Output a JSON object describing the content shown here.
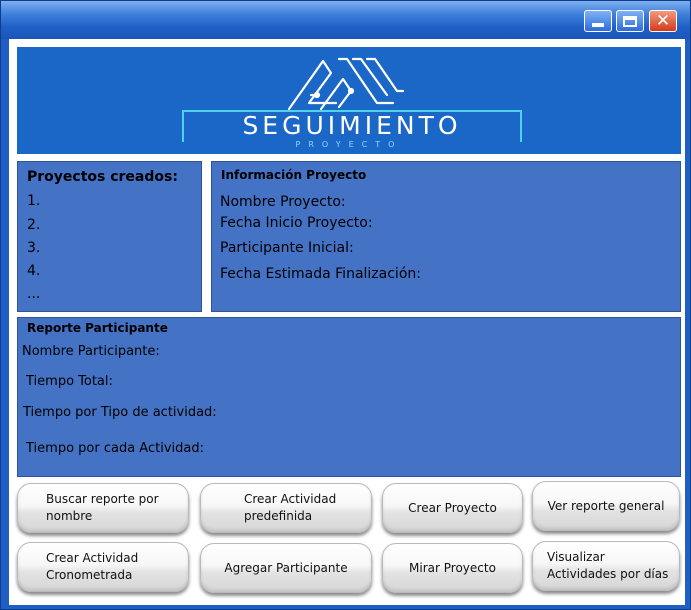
{
  "logo": {
    "title": "SEGUIMIENTO",
    "subtitle": "PROYECTO"
  },
  "projects_panel": {
    "title": "Proyectos creados:",
    "items": [
      "1.",
      "2.",
      "3.",
      "4.",
      "..."
    ]
  },
  "info_panel": {
    "title": "Información Proyecto",
    "fields": [
      "Nombre Proyecto:",
      "Fecha Inicio Proyecto:",
      "Participante Inicial:",
      "Fecha Estimada Finalización:"
    ]
  },
  "report_panel": {
    "title": "Reporte Participante",
    "fields": [
      "Nombre Participante:",
      "Tiempo Total:",
      "Tiempo por Tipo de actividad:",
      "Tiempo por cada Actividad:"
    ]
  },
  "buttons": {
    "search_report": "Buscar reporte por nombre",
    "create_predefined": "Crear Actividad predefinida",
    "create_project": "Crear Proyecto",
    "general_report": "Ver reporte general",
    "create_timed": "Crear Actividad Cronometrada",
    "add_participant": "Agregar Participante",
    "view_project": "Mirar Proyecto",
    "view_by_days": "Visualizar Actividades por días"
  },
  "colors": {
    "titlebar": "#1f5fc5",
    "header": "#1a67c7",
    "panel": "#4472c4",
    "logo_accent": "#4fd3e8",
    "close_button": "#d43a1a"
  }
}
